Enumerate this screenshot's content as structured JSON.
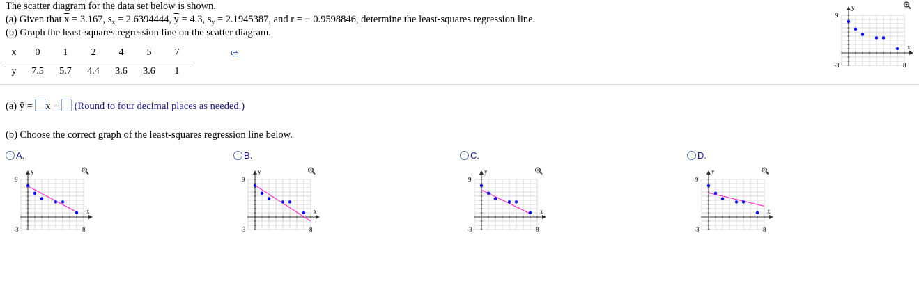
{
  "problem": {
    "intro": "The scatter diagram for the data set below is shown.",
    "given_prefix": "(a) Given that",
    "given_xbar": "x",
    "given_xbar_val": " = 3.167, s",
    "sub_x": "x",
    "given_sx_val": " = 2.6394444,",
    "given_ybar": "y",
    "given_ybar_val": " = 4.3, s",
    "sub_y": "y",
    "given_rest": " = 2.1945387, and r = − 0.9598846, determine the least-squares regression line.",
    "part_b_line": "(b) Graph the least-squares regression line on the scatter diagram."
  },
  "table": {
    "x_label": "x",
    "y_label": "y",
    "x_values": [
      "0",
      "1",
      "2",
      "4",
      "5",
      "7"
    ],
    "y_values": [
      "7.5",
      "5.7",
      "4.4",
      "3.6",
      "3.6",
      "1"
    ]
  },
  "part_a": {
    "prefix": "(a) ",
    "yhat": "ŷ",
    "equals": " = ",
    "x_plus": "x + ",
    "round_note": "(Round to four decimal places as needed.)"
  },
  "part_b": {
    "prompt": "(b) Choose the correct graph of the least-squares regression line below."
  },
  "choices": [
    {
      "label": "A."
    },
    {
      "label": "B."
    },
    {
      "label": "C."
    },
    {
      "label": "D."
    }
  ],
  "axis": {
    "y_label": "y",
    "x_label": "x",
    "y_top": "9",
    "y_bottom": "-3",
    "x_right": "8"
  },
  "colors": {
    "point": "#0000ff",
    "line": "#ff33cc",
    "grid": "#cfcfcf",
    "axis": "#333333",
    "text_blue": "#1a1a8c"
  },
  "icons": {
    "zoom": "magnifier-icon",
    "copy": "copy-table-icon"
  },
  "chart_data": [
    {
      "type": "scatter",
      "name": "main",
      "xlim": [
        -1,
        8
      ],
      "ylim": [
        -3,
        9
      ],
      "points": [
        [
          0,
          7.5
        ],
        [
          1,
          5.7
        ],
        [
          2,
          4.4
        ],
        [
          4,
          3.6
        ],
        [
          5,
          3.6
        ],
        [
          7,
          1
        ]
      ],
      "line": null
    },
    {
      "type": "scatter",
      "name": "A",
      "xlim": [
        -1,
        8
      ],
      "ylim": [
        -3,
        9
      ],
      "points": [
        [
          0,
          7.5
        ],
        [
          1,
          5.7
        ],
        [
          2,
          4.4
        ],
        [
          4,
          3.6
        ],
        [
          5,
          3.6
        ],
        [
          7,
          1
        ]
      ],
      "line": [
        [
          0,
          7.4
        ],
        [
          7,
          1.2
        ]
      ]
    },
    {
      "type": "scatter",
      "name": "B",
      "xlim": [
        -1,
        8
      ],
      "ylim": [
        -3,
        9
      ],
      "points": [
        [
          0,
          7.5
        ],
        [
          1,
          5.7
        ],
        [
          2,
          4.4
        ],
        [
          4,
          3.6
        ],
        [
          5,
          3.6
        ],
        [
          7,
          1
        ]
      ],
      "line": [
        [
          0,
          7.6
        ],
        [
          8,
          -1
        ]
      ]
    },
    {
      "type": "scatter",
      "name": "C",
      "xlim": [
        -1,
        8
      ],
      "ylim": [
        -3,
        9
      ],
      "points": [
        [
          0,
          7.5
        ],
        [
          1,
          5.7
        ],
        [
          2,
          4.4
        ],
        [
          4,
          3.6
        ],
        [
          5,
          3.6
        ],
        [
          7,
          1
        ]
      ],
      "line": [
        [
          0,
          6.5
        ],
        [
          7,
          0.8
        ]
      ]
    },
    {
      "type": "scatter",
      "name": "D",
      "xlim": [
        -1,
        8
      ],
      "ylim": [
        -3,
        9
      ],
      "points": [
        [
          0,
          7.5
        ],
        [
          1,
          5.7
        ],
        [
          2,
          4.4
        ],
        [
          4,
          3.6
        ],
        [
          5,
          3.6
        ],
        [
          7,
          1
        ]
      ],
      "line": [
        [
          0,
          5.8
        ],
        [
          8,
          2.6
        ]
      ]
    }
  ]
}
